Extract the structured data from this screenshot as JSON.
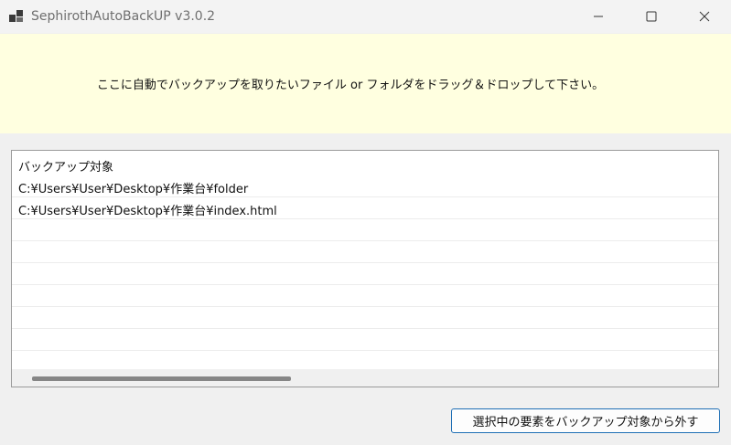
{
  "window": {
    "title": "SephirothAutoBackUP v3.0.2",
    "icons": {
      "app": "app-window-icon",
      "minimize": "minimize-icon",
      "maximize": "maximize-icon",
      "close": "close-icon"
    }
  },
  "drop_zone": {
    "instruction": "ここに自動でバックアップを取りたいファイル or フォルダをドラッグ＆ドロップして下さい。",
    "background": "#ffffe0"
  },
  "backup_list": {
    "header": "バックアップ対象",
    "items": [
      "C:¥Users¥User¥Desktop¥作業台¥folder",
      "C:¥Users¥User¥Desktop¥作業台¥index.html"
    ]
  },
  "actions": {
    "remove_label": "選択中の要素をバックアップ対象から外す",
    "accent": "#1f6fb5"
  }
}
